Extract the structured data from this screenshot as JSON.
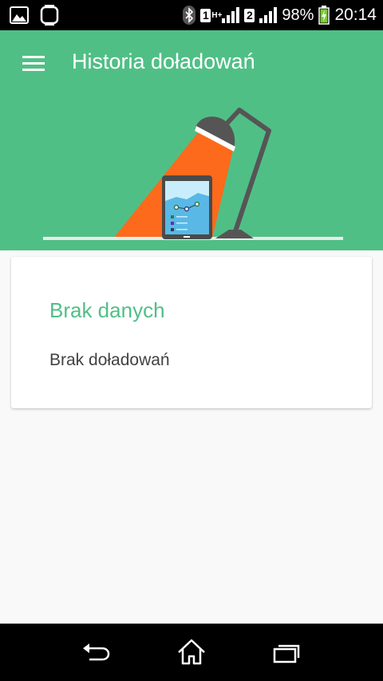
{
  "status_bar": {
    "left_icons": [
      "gallery-notification-icon",
      "smartwatch-notification-icon"
    ],
    "bluetooth_icon": "bluetooth-icon",
    "sim1_label": "1",
    "sim1_network": "H+",
    "sim2_label": "2",
    "battery_percent": "98%",
    "battery_level": 0.98,
    "battery_charging": true,
    "time": "20:14"
  },
  "app_bar": {
    "title": "Historia doładowań",
    "menu_icon": "hamburger-menu-icon",
    "background_color": "#50bf86"
  },
  "illustration": {
    "name": "lamp-and-tablet-illustration",
    "colors": {
      "light_beam": "#fd6a1b",
      "lamp": "#555555",
      "tablet_screen": "#59b8e6",
      "tablet_frame": "#4a4a4a",
      "desk": "#e9ece9"
    }
  },
  "card": {
    "title": "Brak danych",
    "message": "Brak doładowań",
    "title_color": "#50bf86"
  },
  "nav_bar": {
    "buttons": [
      "back-icon",
      "home-icon",
      "recent-apps-icon"
    ]
  }
}
